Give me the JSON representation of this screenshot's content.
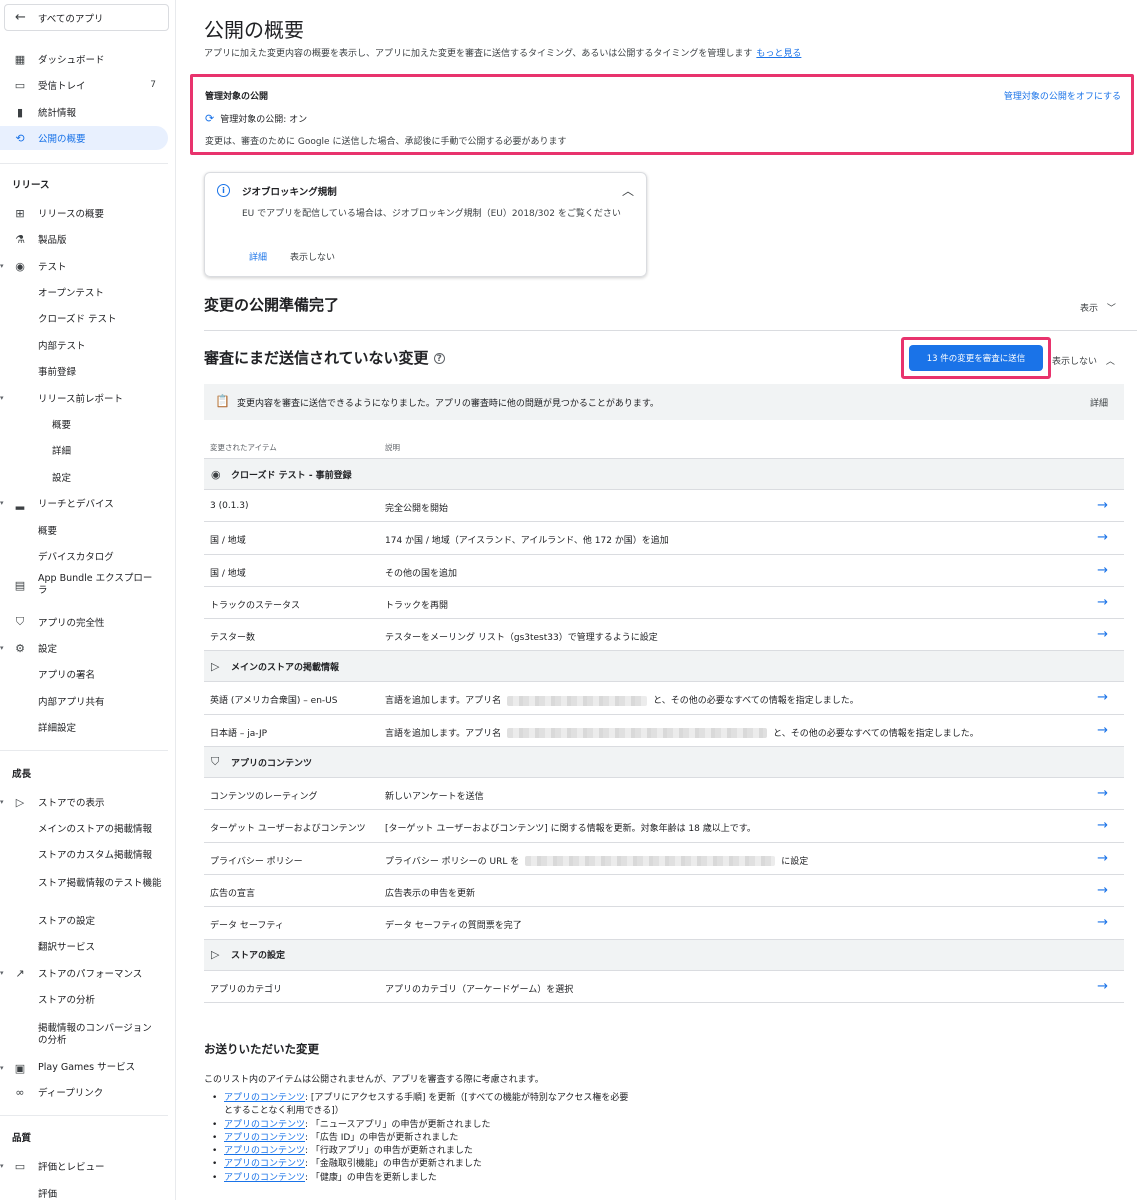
{
  "sidebar": {
    "all_apps": "すべてのアプリ",
    "top": [
      {
        "label": "ダッシュボード",
        "icon": "dashboard-icon"
      },
      {
        "label": "受信トレイ",
        "icon": "inbox-icon",
        "count": "7"
      },
      {
        "label": "統計情報",
        "icon": "bar-chart-icon"
      },
      {
        "label": "公開の概要",
        "icon": "publishing-icon",
        "active": true
      }
    ],
    "release_header": "リリース",
    "release": [
      {
        "label": "リリースの概要",
        "icon": "grid-icon"
      },
      {
        "label": "製品版",
        "icon": "flask-icon"
      },
      {
        "label": "テスト",
        "icon": "play-circle-icon",
        "caret": true
      },
      {
        "label": "オープンテスト"
      },
      {
        "label": "クローズド テスト"
      },
      {
        "label": "内部テスト"
      },
      {
        "label": "事前登録"
      },
      {
        "label": "リリース前レポート",
        "caret": true
      },
      {
        "label": "概要"
      },
      {
        "label": "詳細"
      },
      {
        "label": "設定"
      },
      {
        "label": "リーチとデバイス",
        "icon": "signal-icon",
        "caret": true
      },
      {
        "label": "概要"
      },
      {
        "label": "デバイスカタログ"
      },
      {
        "label": "App Bundle エクスプローラ",
        "icon": "bundle-icon"
      },
      {
        "label": "アプリの完全性",
        "icon": "shield-icon"
      },
      {
        "label": "設定",
        "icon": "gear-icon",
        "caret": true
      },
      {
        "label": "アプリの署名"
      },
      {
        "label": "内部アプリ共有"
      },
      {
        "label": "詳細設定"
      }
    ],
    "growth_header": "成長",
    "growth": [
      {
        "label": "ストアでの表示",
        "icon": "play-store-icon",
        "caret": true
      },
      {
        "label": "メインのストアの掲載情報"
      },
      {
        "label": "ストアのカスタム掲載情報"
      },
      {
        "label": "ストア掲載情報のテスト機能"
      },
      {
        "label": "ストアの設定"
      },
      {
        "label": "翻訳サービス"
      },
      {
        "label": "ストアのパフォーマンス",
        "icon": "trending-icon",
        "caret": true
      },
      {
        "label": "ストアの分析"
      },
      {
        "label": "掲載情報のコンバージョンの分析"
      },
      {
        "label": "Play Games サービス",
        "icon": "gamepad-icon",
        "caret": true
      },
      {
        "label": "ディープリンク",
        "icon": "link-icon"
      }
    ],
    "quality_header": "品質",
    "quality": [
      {
        "label": "評価とレビュー",
        "icon": "review-icon",
        "caret": true
      },
      {
        "label": "評価"
      }
    ]
  },
  "page": {
    "title": "公開の概要",
    "subtitle": "アプリに加えた変更内容の概要を表示し、アプリに加えた変更を審査に送信するタイミング、あるいは公開するタイミングを管理します",
    "learn_more": "もっと見る"
  },
  "managed": {
    "heading": "管理対象の公開",
    "turn_off": "管理対象の公開をオフにする",
    "status": "管理対象の公開: オン",
    "description": "変更は、審査のために Google に送信した場合、承認後に手動で公開する必要があります"
  },
  "geo": {
    "title": "ジオブロッキング規制",
    "body": "EU でアプリを配信している場合は、ジオブロッキング規制（EU）2018/302 をご覧ください",
    "details": "詳細",
    "dismiss": "表示しない"
  },
  "ready": {
    "title": "変更の公開準備完了",
    "toggle": "表示"
  },
  "pending": {
    "title": "審査にまだ送信されていない変更",
    "send_button": "13 件の変更を審査に送信",
    "toggle": "表示しない",
    "notice": "変更内容を審査に送信できるようになりました。アプリの審査時に他の問題が見つかることがあります。",
    "notice_link": "詳細",
    "col_item": "変更されたアイテム",
    "col_desc": "説明",
    "groups": [
      {
        "label": "クローズド テスト - 事前登録",
        "icon": "play-circle-icon",
        "rows": [
          {
            "item": "3 (0.1.3)",
            "desc": "完全公開を開始"
          },
          {
            "item": "国 / 地域",
            "desc": "174 か国 / 地域（アイスランド、アイルランド、他 172 か国）を追加"
          },
          {
            "item": "国 / 地域",
            "desc": "その他の国を追加"
          },
          {
            "item": "トラックのステータス",
            "desc": "トラックを再開"
          },
          {
            "item": "テスター数",
            "desc": "テスターをメーリング リスト（gs3test33）で管理するように設定"
          }
        ]
      },
      {
        "label": "メインのストアの掲載情報",
        "icon": "play-store-icon",
        "rows": [
          {
            "item": "英語 (アメリカ合衆国) – en-US",
            "desc": "言語を追加します。アプリ名",
            "desc2": "と、その他の必要なすべての情報を指定しました。"
          },
          {
            "item": "日本語 – ja-JP",
            "desc": "言語を追加します。アプリ名",
            "desc2": "と、その他の必要なすべての情報を指定しました。"
          }
        ]
      },
      {
        "label": "アプリのコンテンツ",
        "icon": "shield-check-icon",
        "rows": [
          {
            "item": "コンテンツのレーティング",
            "desc": "新しいアンケートを送信"
          },
          {
            "item": "ターゲット ユーザーおよびコンテンツ",
            "desc": "[ターゲット ユーザーおよびコンテンツ] に関する情報を更新。対象年齢は 18 歳以上です。"
          },
          {
            "item": "プライバシー ポリシー",
            "desc": "プライバシー ポリシーの URL を",
            "desc2": "に設定"
          },
          {
            "item": "広告の宣言",
            "desc": "広告表示の申告を更新"
          },
          {
            "item": "データ セーフティ",
            "desc": "データ セーフティの質問票を完了"
          }
        ]
      },
      {
        "label": "ストアの設定",
        "icon": "play-store-icon",
        "rows": [
          {
            "item": "アプリのカテゴリ",
            "desc": "アプリのカテゴリ（アーケードゲーム）を選択"
          }
        ]
      }
    ]
  },
  "submitted": {
    "title": "お送りいただいた変更",
    "description": "このリスト内のアイテムは公開されませんが、アプリを審査する際に考慮されます。",
    "link": "アプリのコンテンツ",
    "items": [
      ": [アプリにアクセスする手順] を更新（[すべての機能が特別なアクセス権を必要とすることなく利用できる]）",
      ": 「ニュースアプリ」の申告が更新されました",
      ": 「広告 ID」の申告が更新されました",
      ": 「行政アプリ」の申告が更新されました",
      ": 「金融取引機能」の申告が更新されました",
      ": 「健康」の申告を更新しました"
    ]
  }
}
